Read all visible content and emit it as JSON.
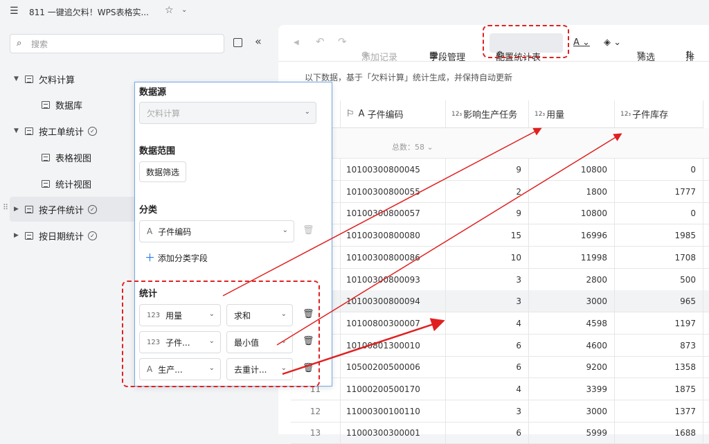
{
  "app": {
    "title": "811 一键追欠料！WPS表格实...",
    "menu_icon": "menu-icon",
    "star_icon": "star-icon"
  },
  "search": {
    "placeholder": "搜索"
  },
  "sidebar": {
    "items": [
      {
        "label": "欠料计算",
        "expanded": true
      },
      {
        "label": "数据库"
      },
      {
        "label": "按工单统计",
        "expanded": true
      },
      {
        "label": "表格视图"
      },
      {
        "label": "统计视图"
      },
      {
        "label": "按子件统计",
        "active": true
      },
      {
        "label": "按日期统计"
      }
    ]
  },
  "toolbar": {
    "add": "添加记录",
    "fields": "字段管理",
    "config": "配置统计表",
    "filter": "筛选",
    "sort": "排"
  },
  "notice": "以下数据，基于「欠料计算」统计生成，并保持自动更新",
  "table": {
    "headers": [
      "子件编码",
      "影响生产任务",
      "用量",
      "子件库存"
    ],
    "summary_label": "总数：",
    "summary_value": "58",
    "rows": [
      {
        "no": "",
        "code": "10100300800045",
        "tasks": "9",
        "qty": "10800",
        "stock": "0"
      },
      {
        "no": "",
        "code": "10100300800055",
        "tasks": "2",
        "qty": "1800",
        "stock": "1777"
      },
      {
        "no": "",
        "code": "10100300800057",
        "tasks": "9",
        "qty": "10800",
        "stock": "0"
      },
      {
        "no": "",
        "code": "10100300800080",
        "tasks": "15",
        "qty": "16996",
        "stock": "1985"
      },
      {
        "no": "",
        "code": "10100300800086",
        "tasks": "10",
        "qty": "11998",
        "stock": "1708"
      },
      {
        "no": "",
        "code": "10100300800093",
        "tasks": "3",
        "qty": "2800",
        "stock": "500"
      },
      {
        "no": "",
        "code": "10100300800094",
        "tasks": "3",
        "qty": "3000",
        "stock": "965"
      },
      {
        "no": "",
        "code": "10100800300007",
        "tasks": "4",
        "qty": "4598",
        "stock": "1197"
      },
      {
        "no": "",
        "code": "10100801300010",
        "tasks": "6",
        "qty": "4600",
        "stock": "873"
      },
      {
        "no": "",
        "code": "10500200500006",
        "tasks": "6",
        "qty": "9200",
        "stock": "1358"
      },
      {
        "no": "11",
        "code": "11000200500170",
        "tasks": "4",
        "qty": "3399",
        "stock": "1875"
      },
      {
        "no": "12",
        "code": "11000300100110",
        "tasks": "3",
        "qty": "3000",
        "stock": "1377"
      },
      {
        "no": "13",
        "code": "11000300300001",
        "tasks": "6",
        "qty": "5999",
        "stock": "1688"
      }
    ]
  },
  "panel": {
    "source_title": "数据源",
    "source_value": "欠料计算",
    "range_title": "数据范围",
    "range_button": "数据筛选",
    "group_title": "分类",
    "group_field": "子件编码",
    "add_group": "添加分类字段",
    "stat_title": "统计",
    "stats": [
      {
        "type": "123",
        "field": "用量",
        "agg": "求和"
      },
      {
        "type": "123",
        "field": "子件...",
        "agg": "最小值"
      },
      {
        "type": "A",
        "field": "生产...",
        "agg": "去重计..."
      }
    ]
  },
  "colors": {
    "accent": "#e02020",
    "link": "#1a73e8"
  }
}
